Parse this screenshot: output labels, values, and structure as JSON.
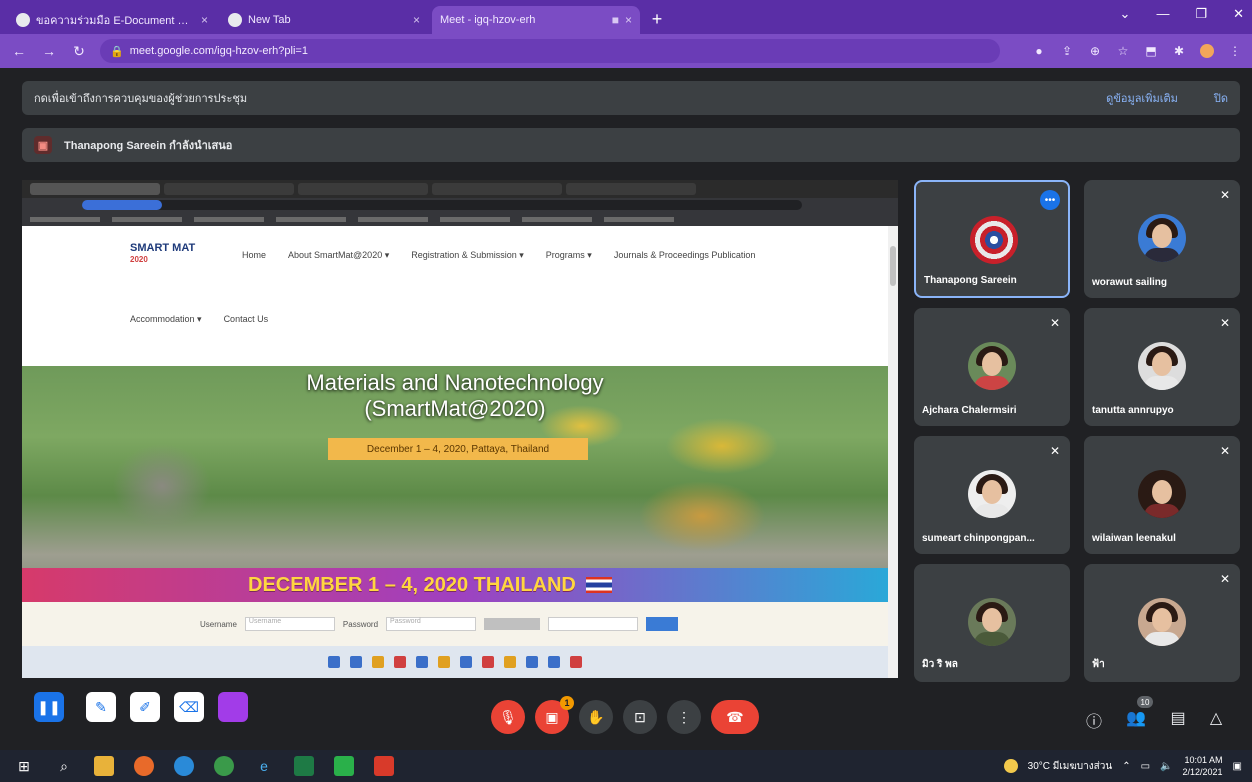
{
  "browser": {
    "tabs": [
      {
        "label": "ขอความร่วมมือ E-Document Syst",
        "active": false
      },
      {
        "label": "New Tab",
        "active": false
      },
      {
        "label": "Meet - igq-hzov-erh",
        "active": true
      }
    ],
    "url": "meet.google.com/igq-hzov-erh?pli=1"
  },
  "meet": {
    "banner_text": "กดเพื่อเข้าถึงการควบคุมของผู้ช่วยการประชุม",
    "banner_actions": [
      "ดูข้อมูลเพิ่มเติม",
      "ปิด"
    ],
    "presenting_text": "Thanapong Sareein กำลังนำเสนอ",
    "shared_screen": {
      "logo_top": "SMART MAT",
      "logo_sub": "2020",
      "menu_row1": [
        "Home",
        "About SmartMat@2020 ▾",
        "Registration & Submission ▾",
        "Programs ▾",
        "Journals & Proceedings Publication"
      ],
      "menu_row2": [
        "Accommodation ▾",
        "Contact Us"
      ],
      "hero_title_line1": "Materials and Nanotechnology",
      "hero_title_line2": "(SmartMat@2020)",
      "hero_date": "December 1 – 4, 2020, Pattaya, Thailand",
      "stripe_text": "DECEMBER 1 – 4, 2020 THAILAND",
      "login_username_label": "Username",
      "login_username_placeholder": "Username",
      "login_password_label": "Password",
      "login_password_placeholder": "Password"
    }
  },
  "participants": [
    {
      "name": "Thanapong Sareein",
      "speaking": true
    },
    {
      "name": "worawut sailing",
      "speaking": false
    },
    {
      "name": "Ajchara Chalermsiri",
      "speaking": false
    },
    {
      "name": "tanutta annrupyo",
      "speaking": false
    },
    {
      "name": "sumeart chinpongpan...",
      "speaking": false
    },
    {
      "name": "wilaiwan leenakul",
      "speaking": false
    },
    {
      "name": "มิว ริ พล",
      "speaking": false
    },
    {
      "name": "ฟ้า",
      "speaking": false
    }
  ],
  "controls": {
    "participant_count": "10",
    "chat_badge": "1"
  },
  "taskbar": {
    "weather": "30°C มีเมฆบางส่วน",
    "time": "10:01 AM",
    "date": "2/12/2021"
  },
  "colors": {
    "chrome_purple": "#7b4cc4",
    "meet_bg": "#202124",
    "end_call_red": "#ea4335",
    "accent_blue": "#8ab4f8"
  }
}
